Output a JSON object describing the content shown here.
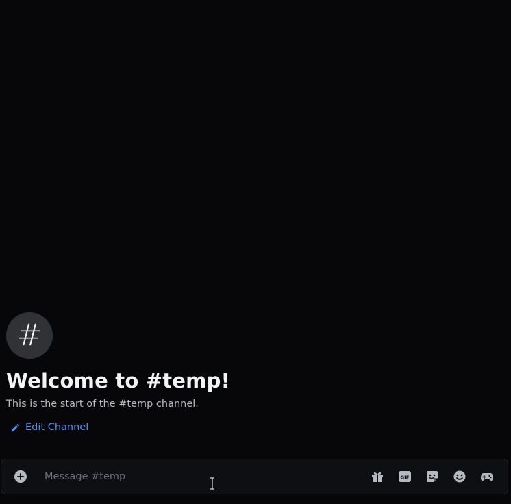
{
  "welcome": {
    "hash_glyph": "#",
    "title": "Welcome to #temp!",
    "subtitle": "This is the start of the #temp channel.",
    "edit_label": "Edit Channel"
  },
  "composer": {
    "placeholder": "Message #temp",
    "gif_label": "GIF"
  },
  "icons": {
    "attach": "plus-circle-icon",
    "gift": "gift-icon",
    "gif": "gif-icon",
    "sticker": "sticker-icon",
    "emoji": "emoji-icon",
    "apps": "gamepad-icon",
    "edit": "pencil-icon"
  },
  "colors": {
    "background": "#070709",
    "link": "#5b8cf0",
    "icon": "#b5bac1"
  }
}
